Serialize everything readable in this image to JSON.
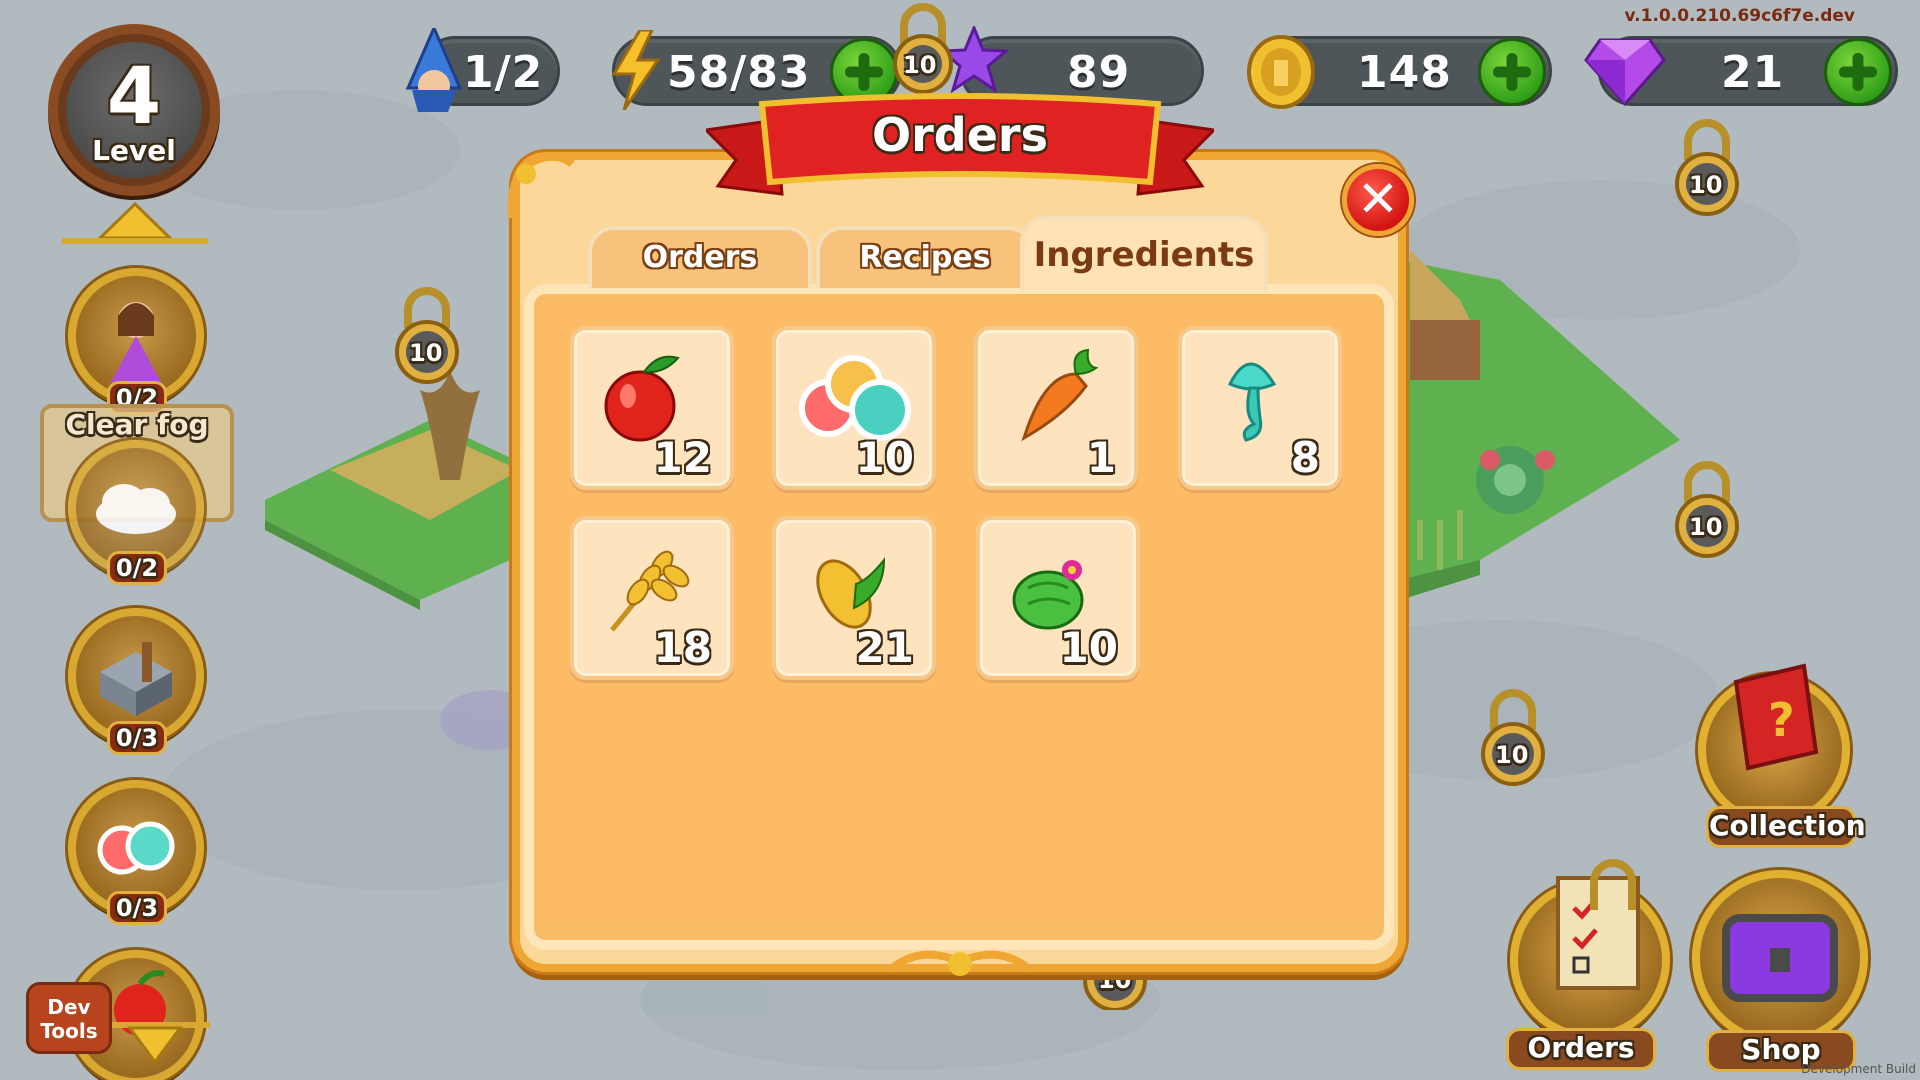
{
  "hud": {
    "version": "v.1.0.0.210.69c6f7e.dev",
    "wizard": "1/2",
    "energy": "58/83",
    "stars": "89",
    "coins": "148",
    "gems": "21",
    "hidden_lock": "10"
  },
  "level": {
    "number": "4",
    "label": "Level"
  },
  "left_panel": {
    "princess_count": "0/2",
    "fog_label": "Clear fog",
    "fog_count": "0/2",
    "building_count": "0/3",
    "candy_count": "0/3"
  },
  "dev_tools": "Dev\nTools",
  "locks": [
    "10",
    "10",
    "10",
    "10",
    "10",
    "10"
  ],
  "dialog": {
    "title": "Orders",
    "tabs": [
      {
        "label": "Orders",
        "active": false
      },
      {
        "label": "Recipes",
        "active": false
      },
      {
        "label": "Ingredients",
        "active": true
      }
    ],
    "items": [
      {
        "icon": "apple-icon",
        "count": "12"
      },
      {
        "icon": "candy-icon",
        "count": "10"
      },
      {
        "icon": "carrot-icon",
        "count": "1"
      },
      {
        "icon": "mushroom-icon",
        "count": "8"
      },
      {
        "icon": "wheat-icon",
        "count": "18"
      },
      {
        "icon": "corn-icon",
        "count": "21"
      },
      {
        "icon": "cactus-icon",
        "count": "10"
      }
    ]
  },
  "right_buttons": {
    "collection": "Collection",
    "orders": "Orders",
    "shop": "Shop"
  },
  "footer_note": "Development Build"
}
